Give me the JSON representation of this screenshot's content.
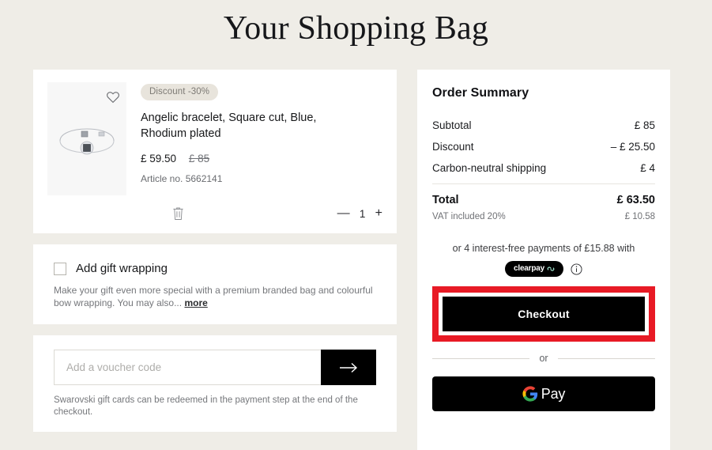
{
  "page": {
    "title": "Your Shopping Bag",
    "background_color": "#EFEDE7",
    "card_color": "#FFFFFF"
  },
  "product": {
    "discount_badge": "Discount -30%",
    "title": "Angelic bracelet, Square cut, Blue, Rhodium plated",
    "price": "£ 59.50",
    "price_original": "£ 85",
    "article_label": "Article no. 5662141",
    "quantity": "1",
    "decrease_label": "—",
    "increase_label": "+",
    "wishlist_icon": "heart-icon",
    "remove_icon": "trash-icon"
  },
  "gift": {
    "checkbox_label": "Add gift wrapping",
    "description": "Make your gift even more special with a premium branded bag and colourful bow wrapping. You may also...",
    "more_label": "more",
    "checked": false
  },
  "voucher": {
    "placeholder": "Add a voucher code",
    "value": "",
    "submit_icon": "arrow-right-icon",
    "note": "Swarovski gift cards can be redeemed in the payment step at the end of the checkout."
  },
  "summary": {
    "title": "Order Summary",
    "lines": [
      {
        "label": "Subtotal",
        "value": "£ 85"
      },
      {
        "label": "Discount",
        "value": "– £ 25.50"
      },
      {
        "label": "Carbon-neutral shipping",
        "value": "£ 4"
      }
    ],
    "total_label": "Total",
    "total_value": "£ 63.50",
    "vat_label": "VAT included 20%",
    "vat_value": "£ 10.58",
    "installments_text": "or 4 interest-free payments of £15.88 with",
    "clearpay_label": "clearpay",
    "clearpay_brand_color": "#B2FCE4",
    "info_icon": "info-circle-icon"
  },
  "actions": {
    "checkout_label": "Checkout",
    "checkout_highlight_color": "#E81A25",
    "or_label": "or",
    "gpay_label": "Pay",
    "gpay_icon": "google-g-icon"
  }
}
